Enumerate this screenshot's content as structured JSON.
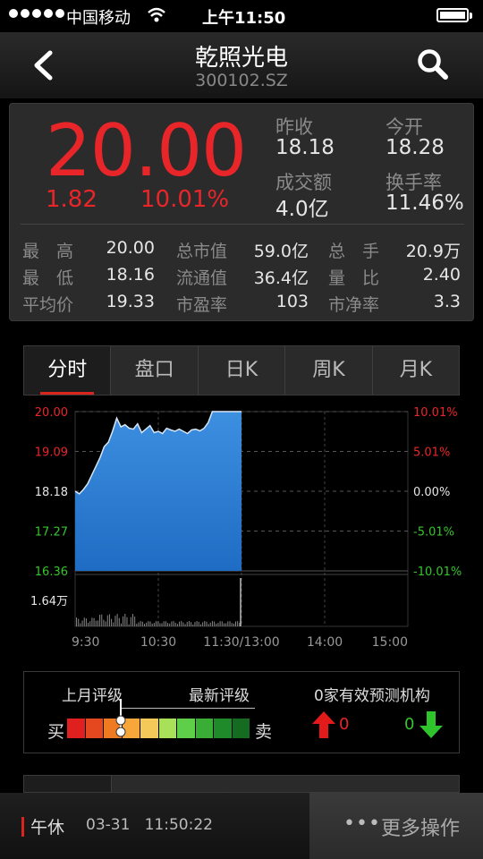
{
  "status_bar": {
    "carrier": "中国移动",
    "time": "上午11:50"
  },
  "header": {
    "title": "乾照光电",
    "code": "300102.SZ"
  },
  "quote": {
    "price": "20.00",
    "change": "1.82",
    "change_pct": "10.01%",
    "prev_close_label": "昨收",
    "prev_close": "18.18",
    "open_label": "今开",
    "open": "18.28",
    "turnover_label": "成交额",
    "turnover": "4.0亿",
    "turnover_rate_label": "换手率",
    "turnover_rate": "11.46%",
    "grid": [
      {
        "label": "最　高",
        "value": "20.00"
      },
      {
        "label": "总市值",
        "value": "59.0亿"
      },
      {
        "label": "总　手",
        "value": "20.9万"
      },
      {
        "label": "最　低",
        "value": "18.16"
      },
      {
        "label": "流通值",
        "value": "36.4亿"
      },
      {
        "label": "量　比",
        "value": "2.40"
      },
      {
        "label": "平均价",
        "value": "19.33"
      },
      {
        "label": "市盈率",
        "value": "103"
      },
      {
        "label": "市净率",
        "value": "3.3"
      }
    ]
  },
  "tabs": [
    "分时",
    "盘口",
    "日K",
    "周K",
    "月K"
  ],
  "chart_data": {
    "type": "area",
    "y_left_ticks": [
      "20.00",
      "19.09",
      "18.18",
      "17.27",
      "16.36"
    ],
    "y_right_ticks": [
      "10.01%",
      "5.01%",
      "0.00%",
      "-5.01%",
      "-10.01%"
    ],
    "x_ticks": [
      "9:30",
      "10:30",
      "11:30/13:00",
      "14:00",
      "15:00"
    ],
    "volume_label": "1.64万",
    "ylim": [
      16.36,
      20.0
    ],
    "price": [
      [
        0,
        18.18
      ],
      [
        3,
        18.12
      ],
      [
        6,
        18.22
      ],
      [
        9,
        18.35
      ],
      [
        12,
        18.55
      ],
      [
        15,
        18.75
      ],
      [
        18,
        18.95
      ],
      [
        21,
        19.2
      ],
      [
        24,
        19.3
      ],
      [
        27,
        19.55
      ],
      [
        30,
        19.85
      ],
      [
        33,
        19.65
      ],
      [
        36,
        19.7
      ],
      [
        39,
        19.62
      ],
      [
        42,
        19.6
      ],
      [
        45,
        19.72
      ],
      [
        48,
        19.52
      ],
      [
        51,
        19.6
      ],
      [
        54,
        19.68
      ],
      [
        57,
        19.52
      ],
      [
        60,
        19.55
      ],
      [
        63,
        19.5
      ],
      [
        66,
        19.62
      ],
      [
        69,
        19.58
      ],
      [
        72,
        19.55
      ],
      [
        75,
        19.6
      ],
      [
        78,
        19.55
      ],
      [
        81,
        19.5
      ],
      [
        84,
        19.58
      ],
      [
        87,
        19.6
      ],
      [
        90,
        19.56
      ],
      [
        93,
        19.62
      ],
      [
        96,
        19.75
      ],
      [
        99,
        20.0
      ],
      [
        102,
        20.0
      ],
      [
        105,
        20.0
      ],
      [
        108,
        20.0
      ],
      [
        111,
        20.0
      ],
      [
        114,
        20.0
      ],
      [
        117,
        20.0
      ],
      [
        120,
        20.0
      ]
    ],
    "volume_spike_minute": 120,
    "color_up": "#e8262a",
    "color_down": "#36c52c",
    "fill_color": "#1f6cc4"
  },
  "rating": {
    "last_month_label": "上月评级",
    "latest_label": "最新评级",
    "buy_label": "买",
    "sell_label": "卖",
    "institutions_label": "0家有效预测机构",
    "up_count": "0",
    "down_count": "0",
    "scale_colors": [
      "#e01f1f",
      "#e5481f",
      "#ee7b22",
      "#f7a73a",
      "#f5c85a",
      "#a9e05a",
      "#5fcf4a",
      "#39ad35",
      "#1e8a2a",
      "#156b22"
    ]
  },
  "bottom_bar": {
    "session": "午休",
    "datetime": "03-31   11:50:22",
    "more_label": "更多操作"
  }
}
